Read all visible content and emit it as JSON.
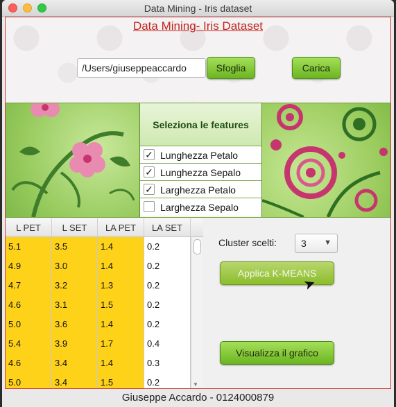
{
  "window": {
    "title": "Data Mining - Iris dataset"
  },
  "app": {
    "heading": "Data Mining- Iris Dataset"
  },
  "file": {
    "path_value": "/Users/giuseppeaccardo",
    "browse_label": "Sfoglia",
    "load_label": "Carica"
  },
  "features": {
    "title": "Seleziona le features",
    "items": [
      {
        "label": "Lunghezza Petalo",
        "checked": "✓"
      },
      {
        "label": "Lunghezza Sepalo",
        "checked": "✓"
      },
      {
        "label": "Larghezza  Petalo",
        "checked": "✓"
      },
      {
        "label": "Larghezza  Sepalo",
        "checked": ""
      }
    ]
  },
  "table": {
    "headers": [
      "L PET",
      "L SET",
      "LA PET",
      "LA SET"
    ],
    "rows": [
      [
        "5.1",
        "3.5",
        "1.4",
        "0.2"
      ],
      [
        "4.9",
        "3.0",
        "1.4",
        "0.2"
      ],
      [
        "4.7",
        "3.2",
        "1.3",
        "0.2"
      ],
      [
        "4.6",
        "3.1",
        "1.5",
        "0.2"
      ],
      [
        "5.0",
        "3.6",
        "1.4",
        "0.2"
      ],
      [
        "5.4",
        "3.9",
        "1.7",
        "0.4"
      ],
      [
        "4.6",
        "3.4",
        "1.4",
        "0.3"
      ],
      [
        "5.0",
        "3.4",
        "1.5",
        "0.2"
      ]
    ]
  },
  "controls": {
    "cluster_label": "Cluster scelti:",
    "cluster_value": "3",
    "kmeans_label": "Applica K-MEANS",
    "chart_label": "Visualizza il grafico"
  },
  "footer": {
    "text": "Giuseppe Accardo - 0124000879"
  },
  "colors": {
    "accent_red": "#c2261f",
    "button_green": "#7cc12e",
    "cell_gold": "#ffd21a",
    "banner_green": "#a9d66b"
  }
}
